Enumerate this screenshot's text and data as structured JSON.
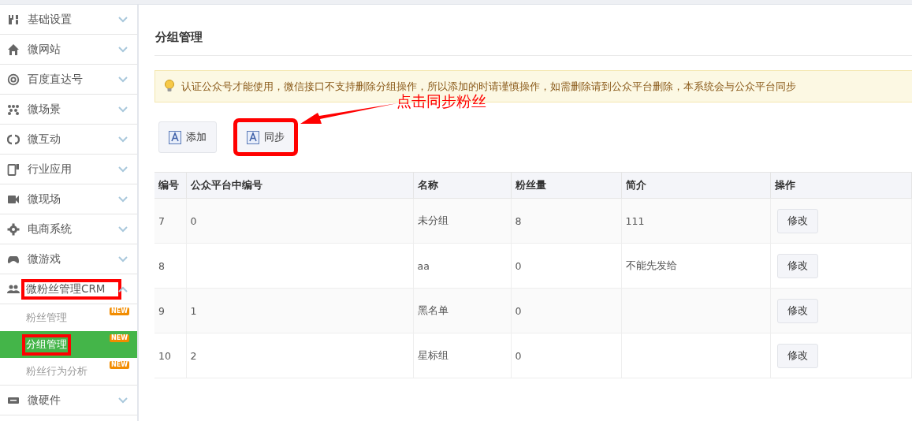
{
  "sidebar": {
    "items": [
      {
        "label": "基础设置",
        "expanded": false,
        "highlighted": false
      },
      {
        "label": "微网站",
        "expanded": false,
        "highlighted": false
      },
      {
        "label": "百度直达号",
        "expanded": false,
        "highlighted": false
      },
      {
        "label": "微场景",
        "expanded": false,
        "highlighted": false
      },
      {
        "label": "微互动",
        "expanded": false,
        "highlighted": false
      },
      {
        "label": "行业应用",
        "expanded": false,
        "highlighted": false
      },
      {
        "label": "微现场",
        "expanded": false,
        "highlighted": false
      },
      {
        "label": "电商系统",
        "expanded": false,
        "highlighted": false
      },
      {
        "label": "微游戏",
        "expanded": false,
        "highlighted": false
      },
      {
        "label": "微粉丝管理CRM",
        "expanded": true,
        "highlighted": true,
        "children": [
          {
            "label": "粉丝管理",
            "badge": "NEW",
            "selected": false,
            "highlighted": false
          },
          {
            "label": "分组管理",
            "badge": "NEW",
            "selected": true,
            "highlighted": true
          },
          {
            "label": "粉丝行为分析",
            "badge": "NEW",
            "selected": false,
            "highlighted": false
          }
        ]
      },
      {
        "label": "微硬件",
        "expanded": false,
        "highlighted": false
      }
    ]
  },
  "page": {
    "title": "分组管理",
    "alert": "认证公众号才能使用，微信接口不支持删除分组操作，所以添加的时请谨慎操作，如需删除请到公众平台删除，本系统会与公众平台同步",
    "buttons": [
      {
        "label": "添加",
        "highlighted": false
      },
      {
        "label": "同步",
        "highlighted": true
      }
    ],
    "annotation": {
      "text": "点击同步粉丝"
    },
    "table": {
      "columns": [
        "编号",
        "公众平台中编号",
        "名称",
        "粉丝量",
        "简介",
        "操作"
      ],
      "rows": [
        {
          "cells": [
            "7",
            "0",
            "未分组",
            "8",
            "111"
          ],
          "action": "修改"
        },
        {
          "cells": [
            "8",
            "",
            "aa",
            "0",
            "不能先发给"
          ],
          "action": "修改"
        },
        {
          "cells": [
            "9",
            "1",
            "黑名单",
            "0",
            ""
          ],
          "action": "修改"
        },
        {
          "cells": [
            "10",
            "2",
            "星标组",
            "0",
            ""
          ],
          "action": "修改"
        }
      ]
    }
  }
}
